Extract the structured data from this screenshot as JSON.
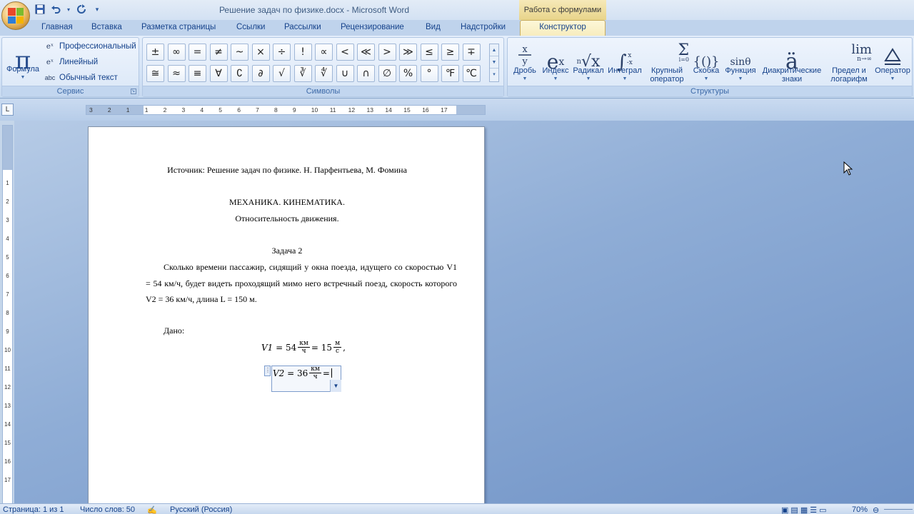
{
  "window": {
    "title": "Решение задач по физике.docx - Microsoft Word",
    "context_tab_header": "Работа с формулами"
  },
  "quick_access": [
    {
      "name": "save-icon",
      "glyph": "💾"
    },
    {
      "name": "undo-icon",
      "glyph": "↶"
    },
    {
      "name": "redo-icon",
      "glyph": "↻"
    },
    {
      "name": "customize-qat-icon",
      "glyph": "▾"
    }
  ],
  "tabs": [
    {
      "label": "Главная"
    },
    {
      "label": "Вставка"
    },
    {
      "label": "Разметка страницы"
    },
    {
      "label": "Ссылки"
    },
    {
      "label": "Рассылки"
    },
    {
      "label": "Рецензирование"
    },
    {
      "label": "Вид"
    },
    {
      "label": "Надстройки"
    },
    {
      "label": "Конструктор",
      "active": true
    }
  ],
  "ribbon": {
    "service": {
      "group_label": "Сервис",
      "formula_label": "Формула",
      "items": [
        "Профессиональный",
        "Линейный",
        "Обычный текст"
      ],
      "item_icon_labels": [
        "abc"
      ]
    },
    "symbols": {
      "group_label": "Символы",
      "row1": [
        "±",
        "∞",
        "=",
        "≠",
        "~",
        "×",
        "÷",
        "!",
        "∝",
        "<",
        "≪",
        ">",
        "≫",
        "≤",
        "≥",
        "∓"
      ],
      "row2": [
        "≅",
        "≈",
        "≡",
        "∀",
        "∁",
        "∂",
        "√",
        "∛",
        "∜",
        "∪",
        "∩",
        "∅",
        "%",
        "°",
        "℉",
        "℃"
      ]
    },
    "structures": {
      "group_label": "Структуры",
      "buttons": [
        {
          "label": "Дробь",
          "icon": "fraction-icon"
        },
        {
          "label": "Индекс",
          "icon": "script-icon"
        },
        {
          "label": "Радикал",
          "icon": "radical-icon"
        },
        {
          "label": "Интеграл",
          "icon": "integral-icon"
        },
        {
          "label": "Крупный оператор",
          "icon": "large-operator-icon"
        },
        {
          "label": "Скобка",
          "icon": "bracket-icon"
        },
        {
          "label": "Функция",
          "icon": "function-icon"
        },
        {
          "label": "Диакритические знаки",
          "icon": "accent-icon"
        },
        {
          "label": "Предел и логарифм",
          "icon": "limit-icon"
        },
        {
          "label": "Оператор",
          "icon": "operator-icon"
        }
      ]
    }
  },
  "document": {
    "source_line": "Источник: Решение задач по физике. Н. Парфентьева, М. Фомина",
    "section_title": "МЕХАНИКА. КИНЕМАТИКА.",
    "subsection_title": "Относительность движения.",
    "task_title": "Задача 2",
    "task_text": "Сколько времени пассажир, сидящий у окна поезда, идущего со скоростью V1 = 54 км/ч, будет видеть проходящий мимо него встречный поезд, скорость которого V2 = 36 км/ч, длина L = 150 м.",
    "given_label": "Дано:",
    "eq1": {
      "var": "V1",
      "eq": "= 54",
      "frac1_num": "км",
      "frac1_den": "ч",
      "eq2": "= 15",
      "frac2_num": "м",
      "frac2_den": "с",
      "tail": ","
    },
    "eq2": {
      "var": "V2",
      "eq": "= 36",
      "frac_num": "км",
      "frac_den": "ч",
      "tail": "="
    }
  },
  "ruler": {
    "h_labels": [
      "3",
      "2",
      "1",
      "1",
      "2",
      "3",
      "4",
      "5",
      "6",
      "7",
      "8",
      "9",
      "10",
      "11",
      "12",
      "13",
      "14",
      "15",
      "16",
      "17"
    ],
    "v_labels": [
      "1",
      "2",
      "3",
      "4",
      "5",
      "6",
      "7",
      "8",
      "9",
      "10",
      "11",
      "12",
      "13",
      "14",
      "15",
      "16",
      "17"
    ],
    "corner_label": "L"
  },
  "status": {
    "page": "Страница: 1 из 1",
    "words": "Число слов: 50",
    "language": "Русский (Россия)",
    "zoom": "70%"
  },
  "colors": {
    "ribbon_bg": "#dae7f7",
    "context_tab": "#e8d48a",
    "workspace": "#8fadd6"
  }
}
